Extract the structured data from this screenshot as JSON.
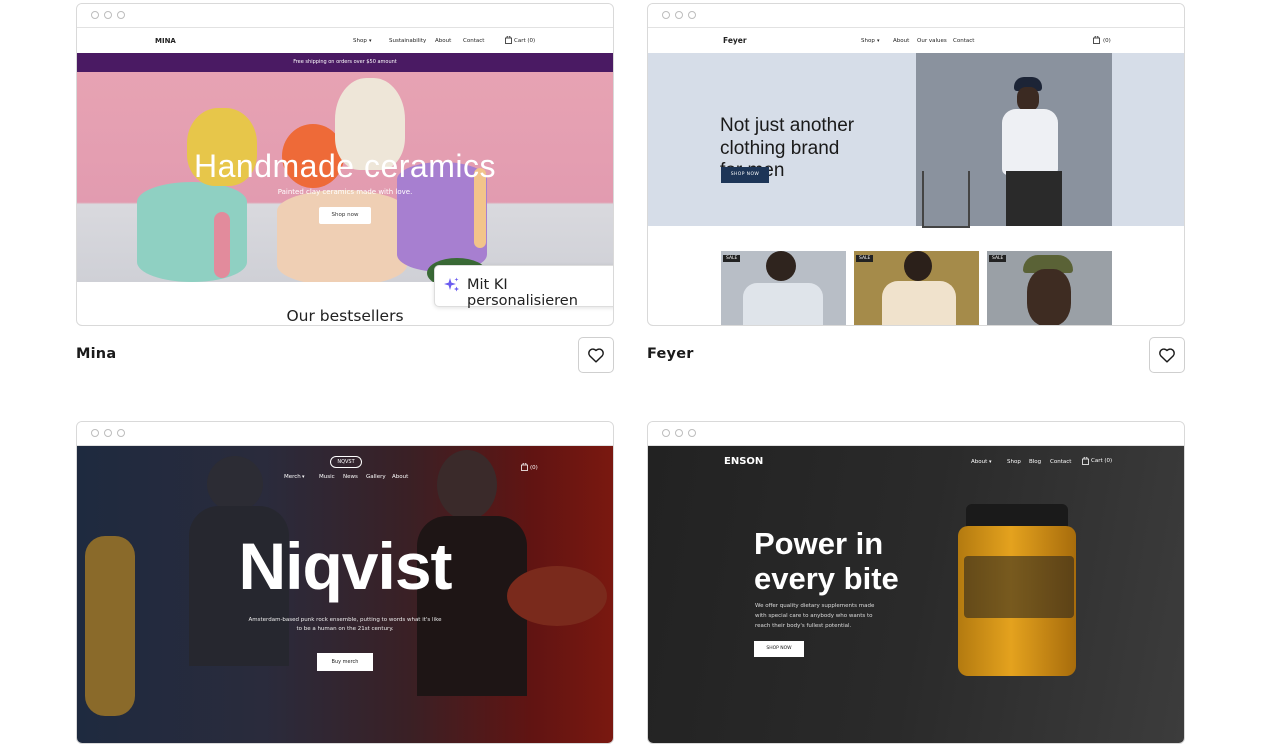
{
  "templates": [
    {
      "name": "Mina",
      "nav": {
        "logo": "MINA",
        "shop": "Shop",
        "sustainability": "Sustainability",
        "about": "About",
        "contact": "Contact",
        "cart": "Cart (0)"
      },
      "banner": "Free shipping on orders over $50 amount",
      "hero_title": "Handmade ceramics",
      "hero_subtitle": "Painted clay ceramics made with love.",
      "hero_button": "Shop now",
      "section_heading": "Our bestsellers",
      "ai_overlay": "Mit KI personalisieren"
    },
    {
      "name": "Feyer",
      "nav": {
        "logo": "Feyer",
        "shop": "Shop",
        "about": "About",
        "values": "Our values",
        "contact": "Contact",
        "cart": "(0)"
      },
      "hero_title_lines": [
        "Not just another",
        "clothing brand",
        "for men"
      ],
      "hero_button": "SHOP NOW",
      "product_badge": "SALE"
    },
    {
      "name": "Niqvist",
      "nav": {
        "logo": "NQVST",
        "merch": "Merch",
        "music": "Music",
        "news": "News",
        "gallery": "Gallery",
        "about": "About",
        "cart": "(0)"
      },
      "hero_title": "Niqvist",
      "hero_subtitle": "Amsterdam-based punk rock ensemble, putting to words what it's like to be a human on the 21st century.",
      "hero_button": "Buy merch"
    },
    {
      "name": "Enson",
      "nav": {
        "logo": "ENSON",
        "about": "About",
        "shop": "Shop",
        "blog": "Blog",
        "contact": "Contact",
        "cart": "Cart (0)"
      },
      "hero_title_lines": [
        "Power in",
        "every bite"
      ],
      "hero_subtitle": "We offer quality dietary supplements made with special care to anybody who wants to reach their body's fullest potential.",
      "hero_button": "SHOP NOW"
    }
  ],
  "icons": {
    "favorite": "heart-icon",
    "ai": "sparkle-icon",
    "cart": "bag-icon",
    "dropdown": "caret-down-icon"
  },
  "colors": {
    "accent_purple": "#4a1a63",
    "feyer_navy": "#1d3557",
    "ai_sparkle": "#6b5cf0"
  }
}
